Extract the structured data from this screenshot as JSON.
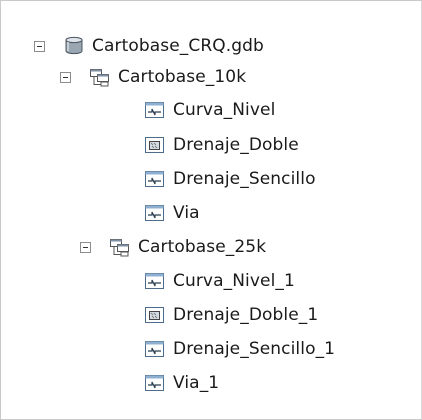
{
  "tree": {
    "root": {
      "label": "Cartobase_CRQ.gdb",
      "icon": "geodatabase-icon",
      "expanded": true
    },
    "datasets": [
      {
        "label": "Cartobase_10k",
        "icon": "feature-dataset-icon",
        "expanded": true,
        "items": [
          {
            "label": "Curva_Nivel",
            "icon": "line-feature-class-icon"
          },
          {
            "label": "Drenaje_Doble",
            "icon": "polygon-feature-class-icon"
          },
          {
            "label": "Drenaje_Sencillo",
            "icon": "line-feature-class-icon"
          },
          {
            "label": "Via",
            "icon": "line-feature-class-icon"
          }
        ]
      },
      {
        "label": "Cartobase_25k",
        "icon": "feature-dataset-icon",
        "expanded": true,
        "items": [
          {
            "label": "Curva_Nivel_1",
            "icon": "line-feature-class-icon"
          },
          {
            "label": "Drenaje_Doble_1",
            "icon": "polygon-feature-class-icon"
          },
          {
            "label": "Drenaje_Sencillo_1",
            "icon": "line-feature-class-icon"
          },
          {
            "label": "Via_1",
            "icon": "line-feature-class-icon"
          }
        ]
      }
    ]
  }
}
